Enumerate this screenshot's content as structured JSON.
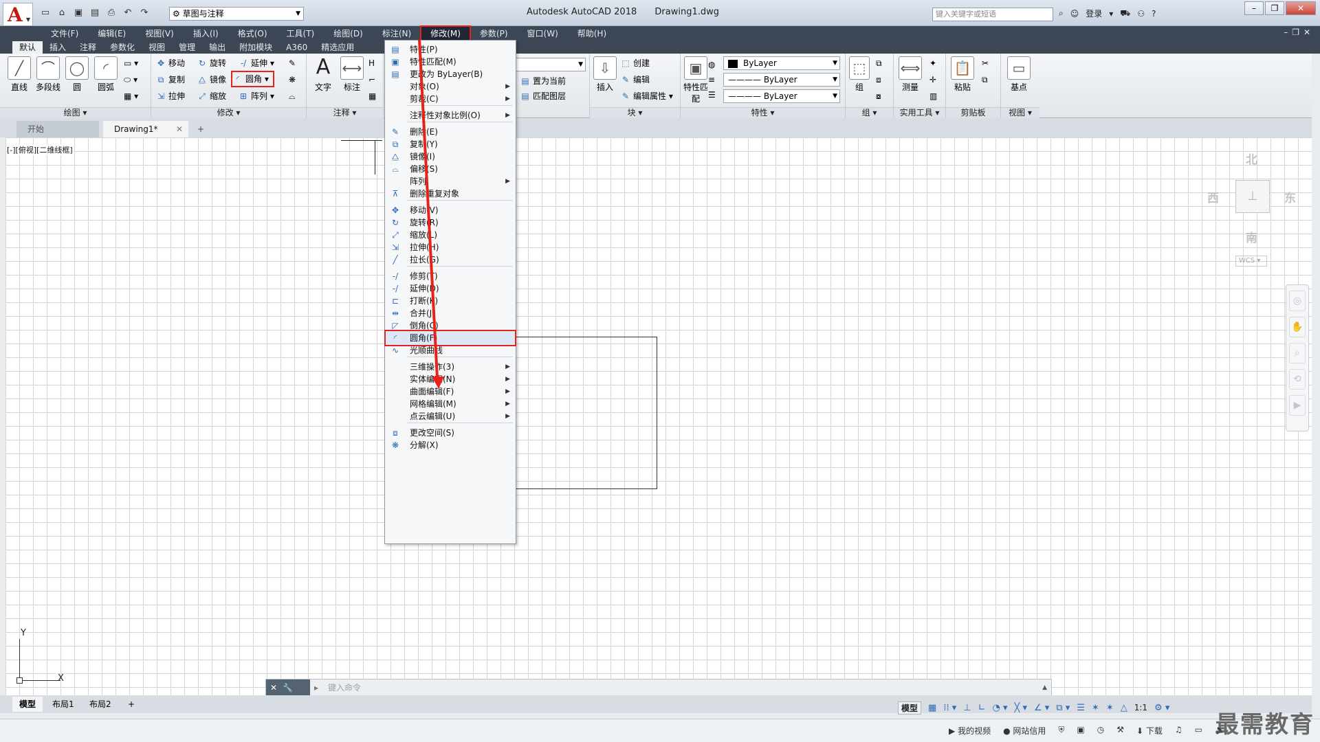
{
  "titlebar": {
    "workspace": "草图与注释",
    "app_name": "Autodesk AutoCAD 2018",
    "file_name": "Drawing1.dwg",
    "search_placeholder": "键入关键字或短语",
    "login": "登录",
    "help": "?"
  },
  "menubar": {
    "items": [
      "文件(F)",
      "编辑(E)",
      "视图(V)",
      "插入(I)",
      "格式(O)",
      "工具(T)",
      "绘图(D)",
      "标注(N)",
      "修改(M)",
      "参数(P)",
      "窗口(W)",
      "帮助(H)"
    ],
    "active": "修改(M)"
  },
  "ribbon_tabs": [
    "默认",
    "插入",
    "注释",
    "参数化",
    "视图",
    "管理",
    "输出",
    "附加模块",
    "A360",
    "精选应用"
  ],
  "ribbon": {
    "draw": {
      "title": "绘图",
      "line": "直线",
      "polyline": "多段线",
      "circle": "圆",
      "arc": "圆弧"
    },
    "modify": {
      "title": "修改",
      "move": "移动",
      "rotate": "旋转",
      "trim": "延伸",
      "copy": "复制",
      "mirror": "镜像",
      "fillet": "圆角",
      "stretch": "拉伸",
      "scale": "缩放",
      "array": "阵列"
    },
    "annotation": {
      "title": "注释",
      "text": "文字",
      "dimension": "标注"
    },
    "block": {
      "title": "块",
      "insert": "插入",
      "create": "创建",
      "edit": "编辑",
      "edit_attr": "编辑属性",
      "set_current": "置为当前",
      "match_layer": "匹配图层"
    },
    "properties": {
      "title": "特性",
      "match": "特性匹配",
      "color": "ByLayer",
      "linetype": "ByLayer",
      "lineweight": "ByLayer"
    },
    "groups": {
      "title": "组",
      "group": "组"
    },
    "utilities": {
      "title": "实用工具",
      "measure": "测量"
    },
    "clipboard": {
      "title": "剪贴板",
      "paste": "粘贴"
    },
    "view": {
      "title": "视图",
      "base": "基点"
    }
  },
  "doc_tabs": {
    "start": "开始",
    "drawing": "Drawing1*"
  },
  "viewport": {
    "label": "[-][俯视][二维线框]",
    "north": "北",
    "south": "南",
    "east": "东",
    "west": "西",
    "wcs": "WCS"
  },
  "ucs": {
    "x": "X",
    "y": "Y"
  },
  "command": {
    "placeholder": "键入命令"
  },
  "layout_tabs": [
    "模型",
    "布局1",
    "布局2"
  ],
  "status": {
    "model": "模型",
    "scale": "1:1"
  },
  "bottom": {
    "video": "我的视频",
    "credit": "网站信用",
    "download": "下载",
    "watermark": "最需教育"
  },
  "dropdown": {
    "items": [
      {
        "label": "特性(P)",
        "icon": "properties-icon"
      },
      {
        "label": "特性匹配(M)",
        "icon": "match-properties-icon"
      },
      {
        "label": "更改为 ByLayer(B)",
        "icon": "bylayer-icon"
      },
      {
        "label": "对象(O)",
        "icon": "",
        "submenu": true
      },
      {
        "label": "剪裁(C)",
        "icon": "",
        "submenu": true
      },
      {
        "label": "注释性对象比例(O)",
        "icon": "",
        "submenu": true
      },
      {
        "label": "删除(E)",
        "icon": "erase-icon"
      },
      {
        "label": "复制(Y)",
        "icon": "copy-icon"
      },
      {
        "label": "镜像(I)",
        "icon": "mirror-icon"
      },
      {
        "label": "偏移(S)",
        "icon": "offset-icon"
      },
      {
        "label": "阵列",
        "icon": "",
        "submenu": true
      },
      {
        "label": "删除重复对象",
        "icon": "overkill-icon"
      },
      {
        "label": "移动(V)",
        "icon": "move-icon"
      },
      {
        "label": "旋转(R)",
        "icon": "rotate-icon"
      },
      {
        "label": "缩放(L)",
        "icon": "scale-icon"
      },
      {
        "label": "拉伸(H)",
        "icon": "stretch-icon"
      },
      {
        "label": "拉长(G)",
        "icon": "lengthen-icon"
      },
      {
        "label": "修剪(T)",
        "icon": "trim-icon"
      },
      {
        "label": "延伸(D)",
        "icon": "extend-icon"
      },
      {
        "label": "打断(K)",
        "icon": "break-icon"
      },
      {
        "label": "合并(J)",
        "icon": "join-icon"
      },
      {
        "label": "倒角(C)",
        "icon": "chamfer-icon"
      },
      {
        "label": "圆角(F)",
        "icon": "fillet-icon",
        "highlight": true
      },
      {
        "label": "光顺曲线",
        "icon": "blend-icon"
      },
      {
        "label": "三维操作(3)",
        "icon": "",
        "submenu": true
      },
      {
        "label": "实体编辑(N)",
        "icon": "",
        "submenu": true
      },
      {
        "label": "曲面编辑(F)",
        "icon": "",
        "submenu": true
      },
      {
        "label": "网格编辑(M)",
        "icon": "",
        "submenu": true
      },
      {
        "label": "点云编辑(U)",
        "icon": "",
        "submenu": true
      },
      {
        "label": "更改空间(S)",
        "icon": "change-space-icon"
      },
      {
        "label": "分解(X)",
        "icon": "explode-icon"
      }
    ]
  },
  "colors": {
    "highlight": "#e8221a",
    "menubar_bg": "#3c4654",
    "accent": "#2d6ab5"
  }
}
